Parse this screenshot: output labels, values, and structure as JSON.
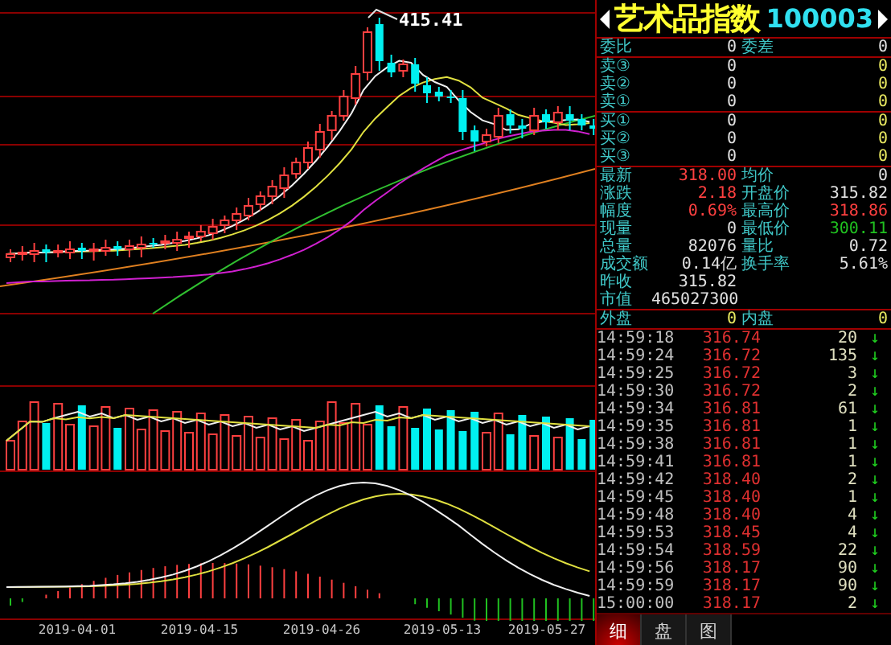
{
  "chart": {
    "high_label": "415.41",
    "dates": [
      "2019-04-01",
      "2019-04-15",
      "2019-04-26",
      "2019-05-13",
      "2019-05-27"
    ]
  },
  "quote": {
    "name": "艺术品指数",
    "code": "100003"
  },
  "order_ratio": [
    {
      "label": "委比",
      "value": "0"
    },
    {
      "label": "委差",
      "value": "0"
    }
  ],
  "asks": [
    {
      "label": "卖③",
      "price": "0",
      "volume": "0"
    },
    {
      "label": "卖②",
      "price": "0",
      "volume": "0"
    },
    {
      "label": "卖①",
      "price": "0",
      "volume": "0"
    }
  ],
  "bids": [
    {
      "label": "买①",
      "price": "0",
      "volume": "0"
    },
    {
      "label": "买②",
      "price": "0",
      "volume": "0"
    },
    {
      "label": "买③",
      "price": "0",
      "volume": "0"
    }
  ],
  "stats": [
    {
      "cells": [
        {
          "label": "最新",
          "value": "318.00",
          "color": "#ff4040"
        },
        {
          "label": "均价",
          "value": "0",
          "color": "#e0e0e0"
        }
      ]
    },
    {
      "cells": [
        {
          "label": "涨跌",
          "value": "2.18",
          "color": "#ff4040"
        },
        {
          "label": "开盘价",
          "value": "315.82",
          "color": "#e0e0e0"
        }
      ]
    },
    {
      "cells": [
        {
          "label": "幅度",
          "value": "0.69%",
          "color": "#ff4040"
        },
        {
          "label": "最高价",
          "value": "318.86",
          "color": "#ff4040"
        }
      ]
    },
    {
      "cells": [
        {
          "label": "现量",
          "value": "0",
          "color": "#e0e0e0"
        },
        {
          "label": "最低价",
          "value": "300.11",
          "color": "#20c020"
        }
      ]
    },
    {
      "cells": [
        {
          "label": "总量",
          "value": "82076",
          "color": "#e0e0e0"
        },
        {
          "label": "量比",
          "value": "0.72",
          "color": "#e0e0e0"
        }
      ]
    },
    {
      "cells": [
        {
          "label": "成交额",
          "value": "0.14亿",
          "color": "#e0e0e0"
        },
        {
          "label": "换手率",
          "value": "5.61%",
          "color": "#e0e0e0"
        }
      ]
    },
    {
      "cells": [
        {
          "label": "昨收",
          "value": "315.82",
          "color": "#e0e0e0"
        }
      ]
    },
    {
      "cells": [
        {
          "label": "市值",
          "value": "465027300",
          "color": "#e0e0e0"
        }
      ]
    }
  ],
  "trade_side": [
    {
      "label": "外盘",
      "value": "0"
    },
    {
      "label": "内盘",
      "value": "0"
    }
  ],
  "ticks": [
    {
      "time": "14:59:18",
      "price": "316.74",
      "volume": "20",
      "arrow": "↓"
    },
    {
      "time": "14:59:24",
      "price": "316.72",
      "volume": "135",
      "arrow": "↓"
    },
    {
      "time": "14:59:25",
      "price": "316.72",
      "volume": "3",
      "arrow": "↓"
    },
    {
      "time": "14:59:30",
      "price": "316.72",
      "volume": "2",
      "arrow": "↓"
    },
    {
      "time": "14:59:34",
      "price": "316.81",
      "volume": "61",
      "arrow": "↓"
    },
    {
      "time": "14:59:35",
      "price": "316.81",
      "volume": "1",
      "arrow": "↓"
    },
    {
      "time": "14:59:38",
      "price": "316.81",
      "volume": "1",
      "arrow": "↓"
    },
    {
      "time": "14:59:41",
      "price": "316.81",
      "volume": "1",
      "arrow": "↓"
    },
    {
      "time": "14:59:42",
      "price": "318.40",
      "volume": "2",
      "arrow": "↓"
    },
    {
      "time": "14:59:45",
      "price": "318.40",
      "volume": "1",
      "arrow": "↓"
    },
    {
      "time": "14:59:48",
      "price": "318.40",
      "volume": "4",
      "arrow": "↓"
    },
    {
      "time": "14:59:53",
      "price": "318.45",
      "volume": "4",
      "arrow": "↓"
    },
    {
      "time": "14:59:54",
      "price": "318.59",
      "volume": "22",
      "arrow": "↓"
    },
    {
      "time": "14:59:56",
      "price": "318.17",
      "volume": "90",
      "arrow": "↓"
    },
    {
      "time": "14:59:59",
      "price": "318.17",
      "volume": "90",
      "arrow": "↓"
    },
    {
      "time": "15:00:00",
      "price": "318.17",
      "volume": "2",
      "arrow": "↓"
    }
  ],
  "tabs": [
    {
      "label": "细",
      "selected": true
    },
    {
      "label": "盘",
      "selected": false
    },
    {
      "label": "图",
      "selected": false
    }
  ]
}
